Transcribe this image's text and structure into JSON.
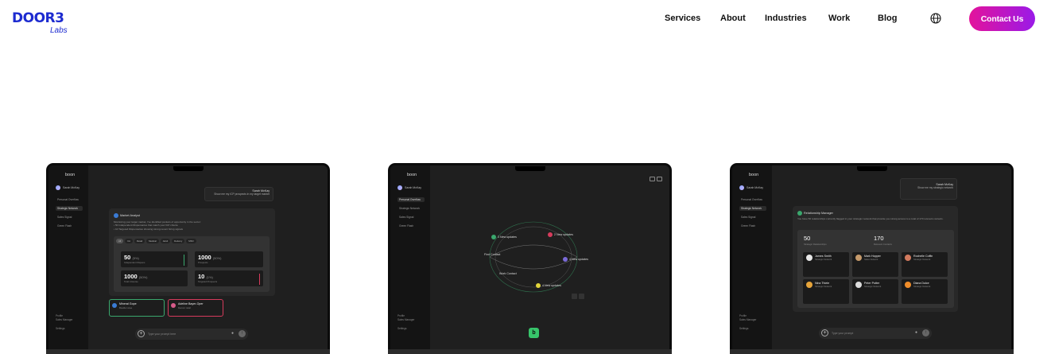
{
  "brand": {
    "logo_main": "DOOR3",
    "logo_sub": "Labs",
    "accent": "#1d2bd0"
  },
  "nav": {
    "items": [
      "Services",
      "About",
      "Industries",
      "Work",
      "Blog"
    ],
    "language_icon": "globe-icon",
    "cta": "Contact Us",
    "cta_gradient": [
      "#e3139b",
      "#9a1ae8"
    ]
  },
  "app": {
    "logo": "boon",
    "user": "Sarah McKay",
    "sidebar_items": [
      "Personal Overflow",
      "Strategic Network",
      "Sales Signal",
      "Green Flash"
    ],
    "sidebar_bottom": [
      "Profile",
      "Sales Manager",
      "Settings"
    ],
    "input_placeholder": "Type your prompt here",
    "input_placeholder_3": "Type your prompt"
  },
  "screen1": {
    "user_name": "Sarah McKay",
    "user_msg": "Show me my ICP prospects in my target market",
    "panel_title": "Market Analyst",
    "panel_text": [
      "Monitoring your target market, I've identified pockets of opportunity in the sector:",
      "• 50 Independent Dispensaries that match your ICP criteria",
      "• 10 Targeted Dispensaries showing strong recent hiring signals"
    ],
    "chips": [
      "All",
      "CA",
      "Retail",
      "Medical",
      "Adult",
      "Delivery",
      "MSO"
    ],
    "metrics": [
      {
        "value": "50",
        "pct": "(5%)",
        "label": "Independent Dispens",
        "bar": "#3aa76d"
      },
      {
        "value": "1000",
        "pct": "(50%)",
        "label": "Prospects",
        "bar": "#555555"
      },
      {
        "value": "1000",
        "pct": "(50%)",
        "label": "Total Universe",
        "bar": "#555555"
      },
      {
        "value": "10",
        "pct": "(1%)",
        "label": "Targeted Prospects",
        "bar": "#d63b5c"
      }
    ],
    "leads": [
      {
        "name": "Mineral Gope",
        "sub": "Boulder area",
        "color": "#3aa76d"
      },
      {
        "name": "Adeline Bayer-Oper",
        "sub": "Denver retail",
        "color": "#d63b5c"
      }
    ]
  },
  "screen2": {
    "nodes": [
      "3 New updates",
      "2 New updates",
      "4 New updates",
      "4 New updates",
      "Find Contact",
      "Work Contact"
    ]
  },
  "screen3": {
    "user_name": "Sarah McKay",
    "user_msg": "Show me my strategic network",
    "panel_title": "Relationship Manager",
    "panel_text": "You have 50 relationships currently flagged in your strategic network that provide you strong access to a total of 170 relevant contacts.",
    "stats": [
      {
        "value": "50",
        "label": "Strategic Relationships"
      },
      {
        "value": "170",
        "label": "Relevant Contacts"
      }
    ],
    "people": [
      {
        "name": "James Smith",
        "role": "Strategic Network",
        "color": "#e8e8e8"
      },
      {
        "name": "Mark Hopper",
        "role": "Sales Network",
        "color": "#c59a6b"
      },
      {
        "name": "Rochelle Coffin",
        "role": "Strategic Network",
        "color": "#d17a5e"
      },
      {
        "name": "Nina Thiele",
        "role": "Strategic Network",
        "color": "#e6a43a"
      },
      {
        "name": "Peter Potter",
        "role": "Strategic Network",
        "color": "#dcdcdc"
      },
      {
        "name": "Diana Dulce",
        "role": "Strategic Network",
        "color": "#f08d2a"
      }
    ]
  }
}
